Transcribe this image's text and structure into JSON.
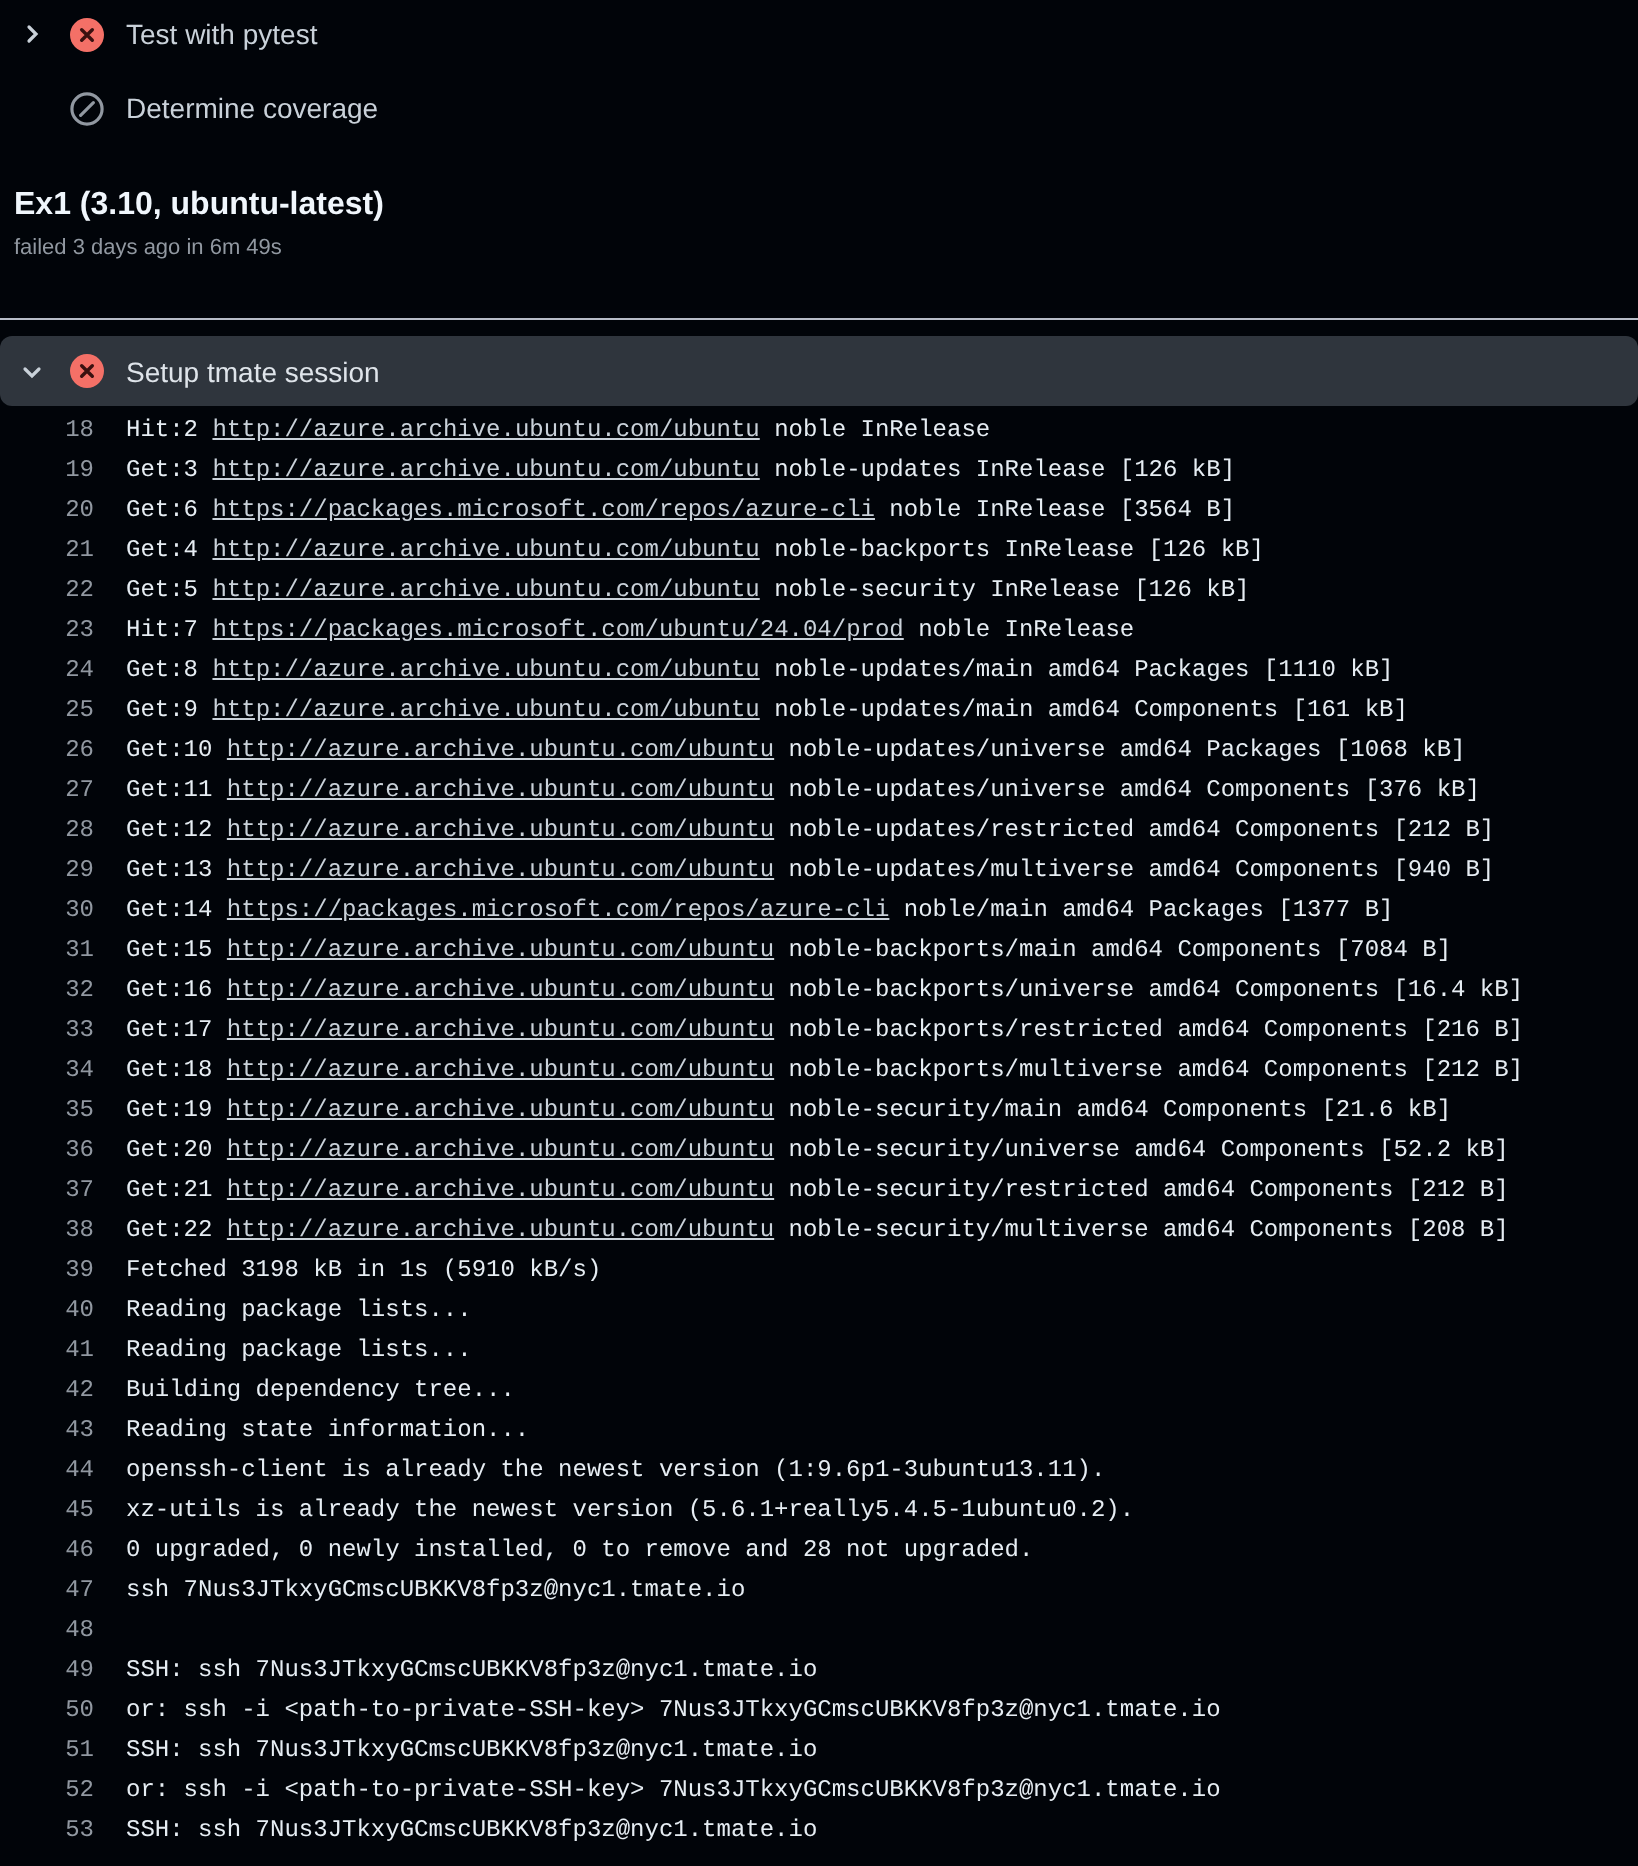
{
  "steps_top": [
    {
      "name": "Test with pytest",
      "kind": "failed",
      "expanded": false
    },
    {
      "name": "Determine coverage",
      "kind": "skipped"
    }
  ],
  "job": {
    "title": "Ex1 (3.10, ubuntu-latest)",
    "subtitle": "failed 3 days ago in 6m 49s"
  },
  "open_step": {
    "name": "Setup tmate session",
    "kind": "failed",
    "expanded": true
  },
  "log_lines": [
    {
      "n": "18",
      "before": "Hit:2",
      "link": "http://azure.archive.ubuntu.com/ubuntu",
      "after": "noble InRelease"
    },
    {
      "n": "19",
      "before": "Get:3",
      "link": "http://azure.archive.ubuntu.com/ubuntu",
      "after": "noble-updates InRelease [126 kB]"
    },
    {
      "n": "20",
      "before": "Get:6",
      "link": "https://packages.microsoft.com/repos/azure-cli",
      "after": "noble InRelease [3564 B]"
    },
    {
      "n": "21",
      "before": "Get:4",
      "link": "http://azure.archive.ubuntu.com/ubuntu",
      "after": "noble-backports InRelease [126 kB]"
    },
    {
      "n": "22",
      "before": "Get:5",
      "link": "http://azure.archive.ubuntu.com/ubuntu",
      "after": "noble-security InRelease [126 kB]"
    },
    {
      "n": "23",
      "before": "Hit:7",
      "link": "https://packages.microsoft.com/ubuntu/24.04/prod",
      "after": "noble InRelease"
    },
    {
      "n": "24",
      "before": "Get:8",
      "link": "http://azure.archive.ubuntu.com/ubuntu",
      "after": "noble-updates/main amd64 Packages [1110 kB]"
    },
    {
      "n": "25",
      "before": "Get:9",
      "link": "http://azure.archive.ubuntu.com/ubuntu",
      "after": "noble-updates/main amd64 Components [161 kB]"
    },
    {
      "n": "26",
      "before": "Get:10",
      "link": "http://azure.archive.ubuntu.com/ubuntu",
      "after": "noble-updates/universe amd64 Packages [1068 kB]"
    },
    {
      "n": "27",
      "before": "Get:11",
      "link": "http://azure.archive.ubuntu.com/ubuntu",
      "after": "noble-updates/universe amd64 Components [376 kB]"
    },
    {
      "n": "28",
      "before": "Get:12",
      "link": "http://azure.archive.ubuntu.com/ubuntu",
      "after": "noble-updates/restricted amd64 Components [212 B]"
    },
    {
      "n": "29",
      "before": "Get:13",
      "link": "http://azure.archive.ubuntu.com/ubuntu",
      "after": "noble-updates/multiverse amd64 Components [940 B]"
    },
    {
      "n": "30",
      "before": "Get:14",
      "link": "https://packages.microsoft.com/repos/azure-cli",
      "after": "noble/main amd64 Packages [1377 B]"
    },
    {
      "n": "31",
      "before": "Get:15",
      "link": "http://azure.archive.ubuntu.com/ubuntu",
      "after": "noble-backports/main amd64 Components [7084 B]"
    },
    {
      "n": "32",
      "before": "Get:16",
      "link": "http://azure.archive.ubuntu.com/ubuntu",
      "after": "noble-backports/universe amd64 Components [16.4 kB]"
    },
    {
      "n": "33",
      "before": "Get:17",
      "link": "http://azure.archive.ubuntu.com/ubuntu",
      "after": "noble-backports/restricted amd64 Components [216 B]"
    },
    {
      "n": "34",
      "before": "Get:18",
      "link": "http://azure.archive.ubuntu.com/ubuntu",
      "after": "noble-backports/multiverse amd64 Components [212 B]"
    },
    {
      "n": "35",
      "before": "Get:19",
      "link": "http://azure.archive.ubuntu.com/ubuntu",
      "after": "noble-security/main amd64 Components [21.6 kB]"
    },
    {
      "n": "36",
      "before": "Get:20",
      "link": "http://azure.archive.ubuntu.com/ubuntu",
      "after": "noble-security/universe amd64 Components [52.2 kB]"
    },
    {
      "n": "37",
      "before": "Get:21",
      "link": "http://azure.archive.ubuntu.com/ubuntu",
      "after": "noble-security/restricted amd64 Components [212 B]"
    },
    {
      "n": "38",
      "before": "Get:22",
      "link": "http://azure.archive.ubuntu.com/ubuntu",
      "after": "noble-security/multiverse amd64 Components [208 B]"
    },
    {
      "n": "39",
      "text": "Fetched 3198 kB in 1s (5910 kB/s)"
    },
    {
      "n": "40",
      "text": "Reading package lists..."
    },
    {
      "n": "41",
      "text": "Reading package lists..."
    },
    {
      "n": "42",
      "text": "Building dependency tree..."
    },
    {
      "n": "43",
      "text": "Reading state information..."
    },
    {
      "n": "44",
      "text": "openssh-client is already the newest version (1:9.6p1-3ubuntu13.11)."
    },
    {
      "n": "45",
      "text": "xz-utils is already the newest version (5.6.1+really5.4.5-1ubuntu0.2)."
    },
    {
      "n": "46",
      "text": "0 upgraded, 0 newly installed, 0 to remove and 28 not upgraded."
    },
    {
      "n": "47",
      "text": "ssh 7Nus3JTkxyGCmscUBKKV8fp3z@nyc1.tmate.io"
    },
    {
      "n": "48"
    },
    {
      "n": "49",
      "text": "SSH: ssh 7Nus3JTkxyGCmscUBKKV8fp3z@nyc1.tmate.io"
    },
    {
      "n": "50",
      "text": "or: ssh -i <path-to-private-SSH-key> 7Nus3JTkxyGCmscUBKKV8fp3z@nyc1.tmate.io"
    },
    {
      "n": "51",
      "text": "SSH: ssh 7Nus3JTkxyGCmscUBKKV8fp3z@nyc1.tmate.io"
    },
    {
      "n": "52",
      "text": "or: ssh -i <path-to-private-SSH-key> 7Nus3JTkxyGCmscUBKKV8fp3z@nyc1.tmate.io"
    },
    {
      "n": "53",
      "text": "SSH: ssh 7Nus3JTkxyGCmscUBKKV8fp3z@nyc1.tmate.io"
    }
  ]
}
